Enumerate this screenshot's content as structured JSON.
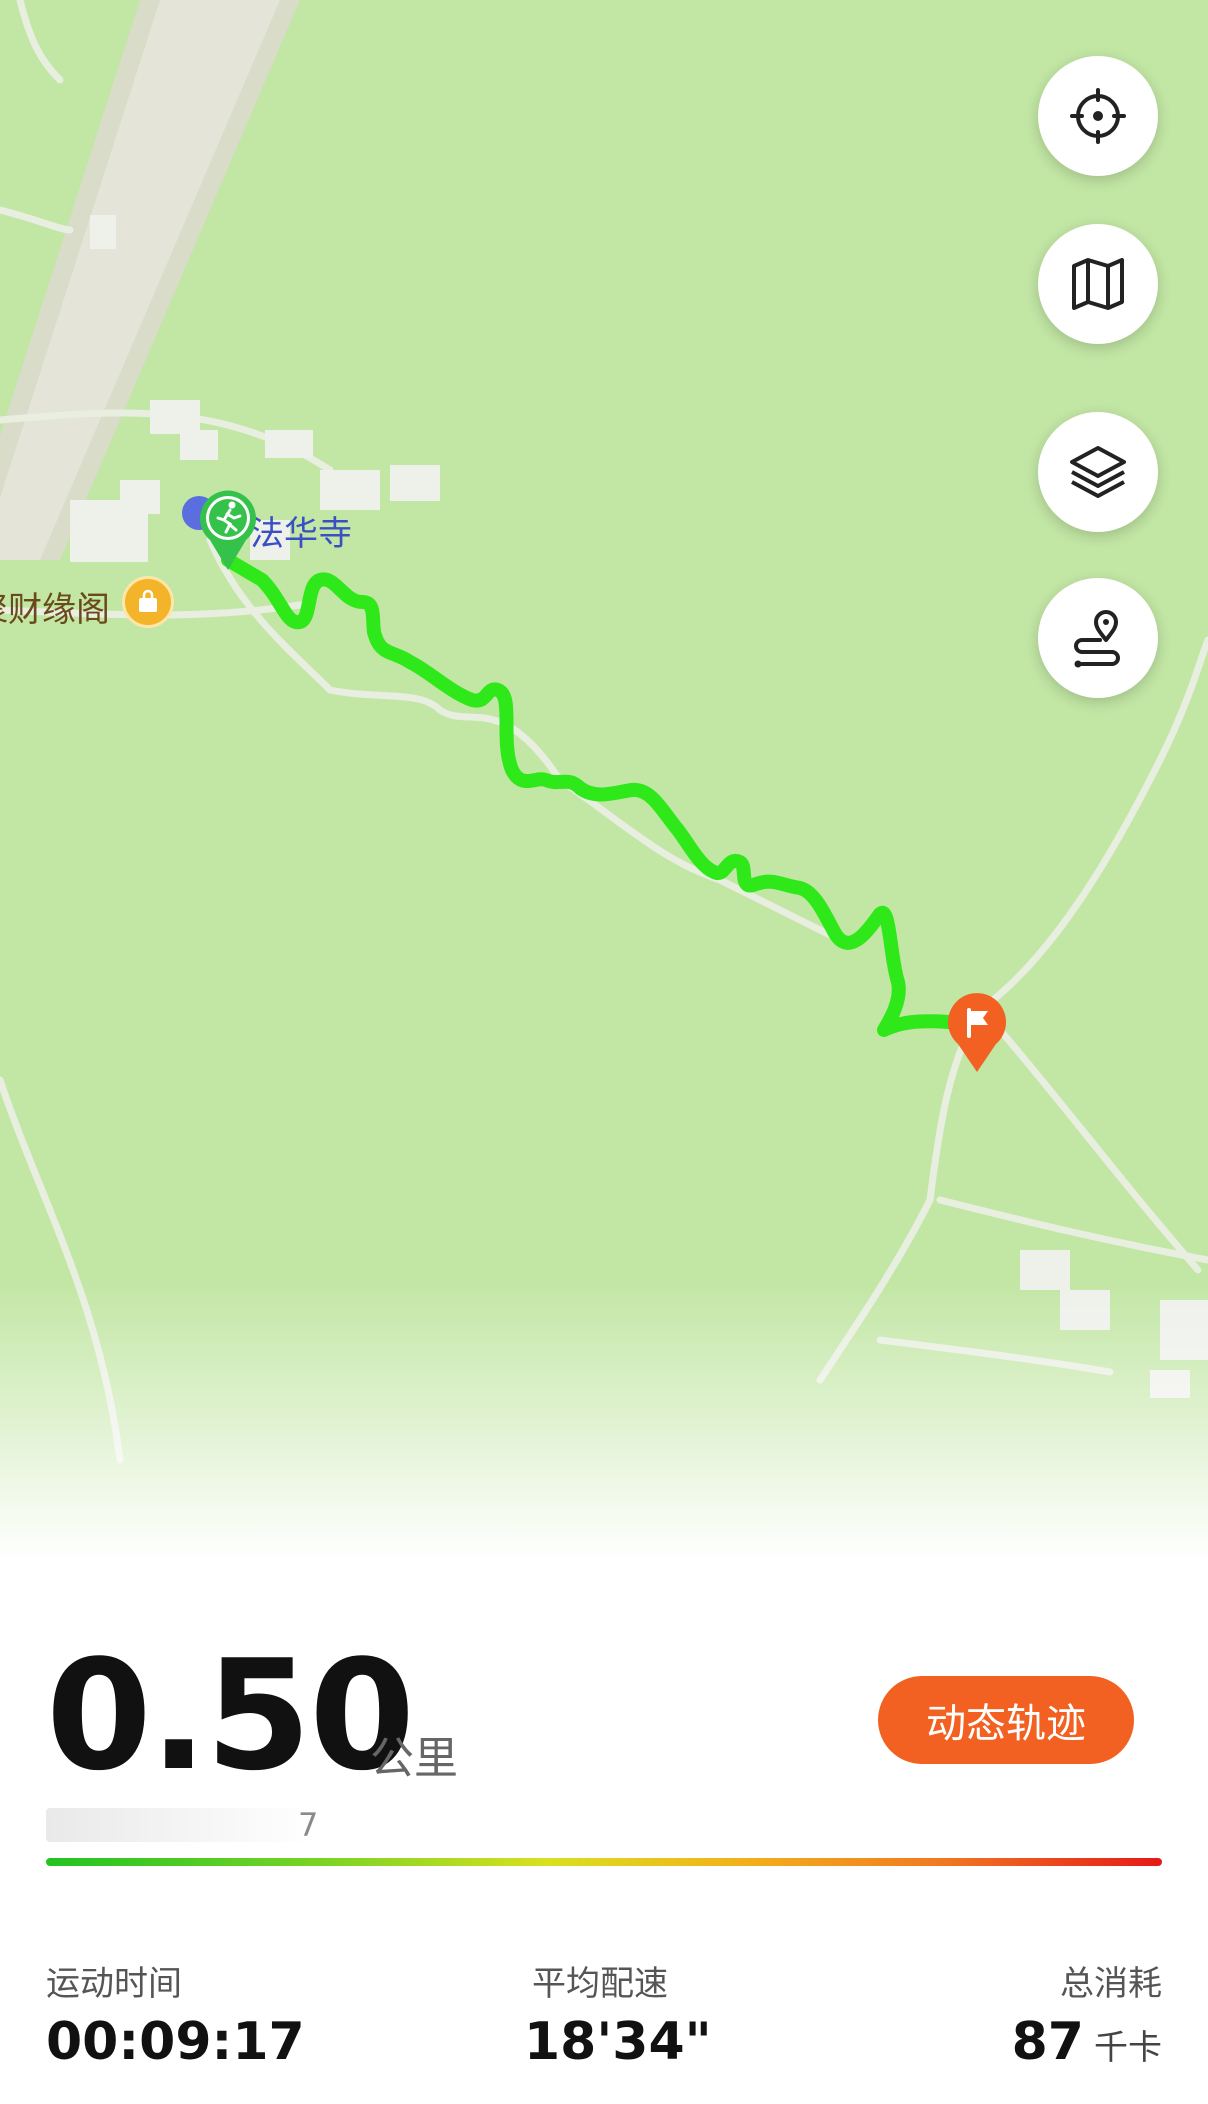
{
  "map": {
    "poi_temple": "法华寺",
    "poi_shop": "聚财缘阁",
    "start_icon": "runner-start-icon",
    "end_icon": "finish-flag-icon",
    "route_color": "#2ee81a",
    "land_color": "#c2e6a4"
  },
  "controls": {
    "locate_icon": "locate-crosshair-icon",
    "map_icon": "map-fold-icon",
    "layers_icon": "layers-icon",
    "route_icon": "route-pin-icon"
  },
  "summary": {
    "distance": "0.50",
    "distance_unit": "公里",
    "replay_label": "动态轨迹",
    "obscured_suffix": "7",
    "accent": "#f26122"
  },
  "stats": {
    "time_label": "运动时间",
    "time_value": "00:09:17",
    "pace_label": "平均配速",
    "pace_value": "18'34\"",
    "calories_label": "总消耗",
    "calories_value": "87",
    "calories_unit": "千卡"
  }
}
